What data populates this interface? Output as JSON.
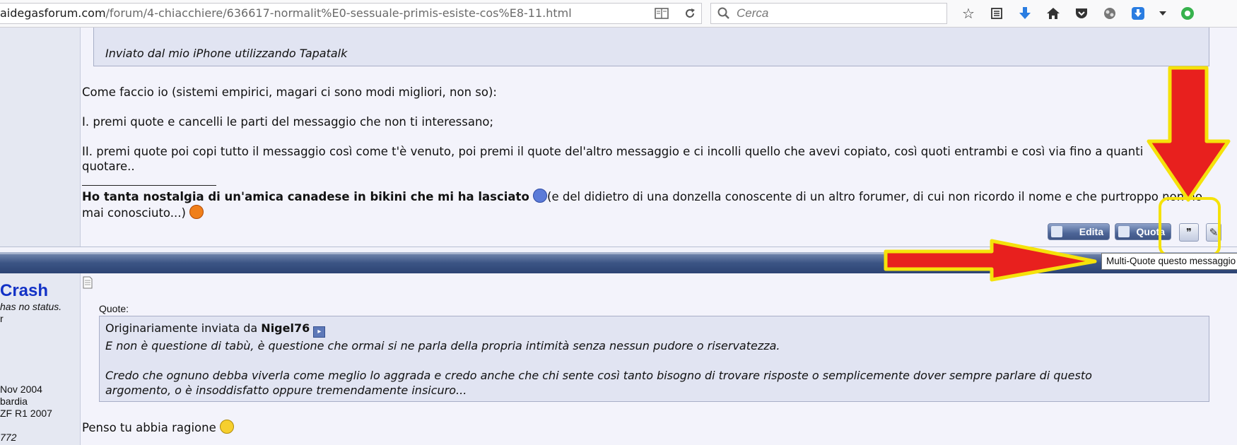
{
  "browser": {
    "url_host": "aidegasforum.com",
    "url_path": "/forum/4-chiacchiere/636617-normalit%E0-sessuale-primis-esiste-cos%E8-11.html",
    "search_placeholder": "Cerca",
    "toolbar_icons": [
      "star-icon",
      "reading-list-icon",
      "download-icon",
      "home-icon",
      "pocket-icon",
      "extension-icon",
      "download-manager-icon",
      "menu-chevron-icon",
      "addon-green-icon"
    ]
  },
  "post1": {
    "quote_signature": "Inviato dal mio iPhone utilizzando Tapatalk",
    "body": [
      "Come faccio io (sistemi empirici, magari ci sono modi migliori, non so):",
      "I. premi quote e cancelli le parti del messaggio che non ti interessano;",
      "II. premi quote poi copi tutto il messaggio così come t'è venuto, poi premi il quote del'altro messaggio e ci incolli quello che avevi copiato, così quoti entrambi e così via fino a quanti",
      "quotare.."
    ],
    "signature_bold": "Ho tanta nostalgia di un'amica canadese in bikini che mi ha lasciato",
    "signature_rest": "(e del didietro di una donzella conoscente di un altro forumer, di cui non ricordo il nome e che purtroppo non ho",
    "signature_line2": "mai conosciuto...)",
    "buttons": {
      "edit": "Edita",
      "quote": "Quota"
    }
  },
  "tooltip": "Multi-Quote questo messaggio",
  "post2": {
    "username": "Crash",
    "user_status": "has no status.",
    "user_rank": "r",
    "join_date": "Nov 2004",
    "location": "bardia",
    "bike": "ZF R1 2007",
    "posts": "772",
    "quote_label": "Quote:",
    "quote_intro": "Originariamente inviata da",
    "quote_author": "Nigel76",
    "quote_lines": [
      "E non è questione di tabù, è questione che ormai si ne parla della propria intimità senza nessun pudore o riservatezza.",
      "Credo che ognuno debba viverla come meglio lo aggrada e credo anche che chi sente così tanto bisogno di trovare risposte o semplicemente dover sempre parlare di questo",
      "argomento, o è insoddisfatto oppure tremendamente insicuro..."
    ],
    "reply": "Penso tu abbia ragione"
  },
  "colors": {
    "arrow": "#e8201e",
    "highlight": "#f5e20a",
    "username": "#1332c6",
    "band": "#3c5585"
  }
}
